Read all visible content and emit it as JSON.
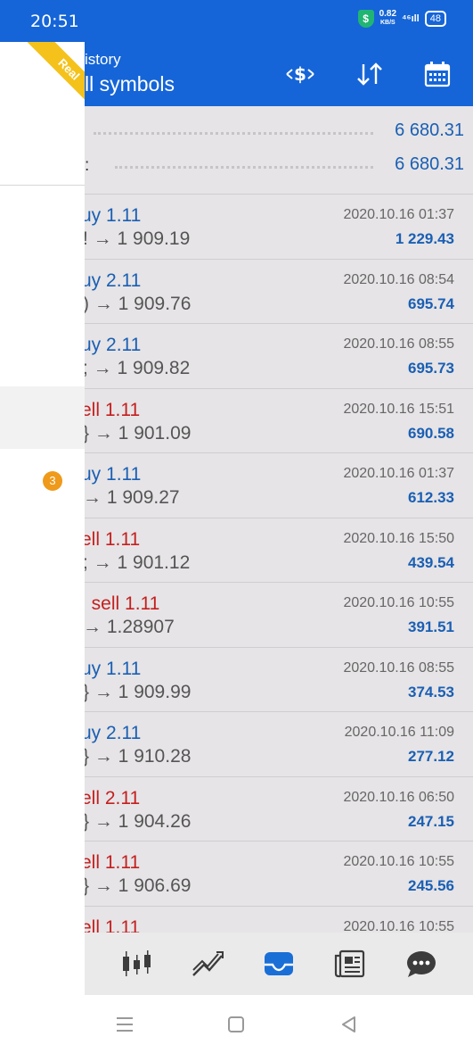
{
  "status_bar": {
    "time": "20:51",
    "speed_top": "0.82",
    "speed_bottom": "KB/S",
    "signal": "⁴⁶ıll",
    "battery": "48"
  },
  "header": {
    "subtitle": "istory",
    "title": "ll symbols"
  },
  "summary": [
    {
      "label": "",
      "value": "6 680.31"
    },
    {
      "label": ":",
      "value": "6 680.31"
    }
  ],
  "trades": [
    {
      "title": "uy 1.11",
      "type": "buy",
      "price": "! → 1 909.19",
      "date": "2020.10.16 01:37",
      "profit": "1 229.43"
    },
    {
      "title": "uy 2.11",
      "type": "buy",
      "price": ") → 1 909.76",
      "date": "2020.10.16 08:54",
      "profit": "695.74"
    },
    {
      "title": "uy 2.11",
      "type": "buy",
      "price": "; → 1 909.82",
      "date": "2020.10.16 08:55",
      "profit": "695.73"
    },
    {
      "title": "ell 1.11",
      "type": "sell",
      "price": "} → 1 901.09",
      "date": "2020.10.16 15:51",
      "profit": "690.58"
    },
    {
      "title": "uy 1.11",
      "type": "buy",
      "price": " → 1 909.27",
      "date": "2020.10.16 01:37",
      "profit": "612.33"
    },
    {
      "title": "ell 1.11",
      "type": "sell",
      "price": "; → 1 901.12",
      "date": "2020.10.16 15:50",
      "profit": "439.54"
    },
    {
      "title": ", sell 1.11",
      "type": "sell",
      "price": " → 1.28907",
      "date": "2020.10.16 10:55",
      "profit": "391.51"
    },
    {
      "title": "uy 1.11",
      "type": "buy",
      "price": "} → 1 909.99",
      "date": "2020.10.16 08:55",
      "profit": "374.53"
    },
    {
      "title": "uy 2.11",
      "type": "buy",
      "price": "} → 1 910.28",
      "date": "2020.10.16 11:09",
      "profit": "277.12"
    },
    {
      "title": "ell 2.11",
      "type": "sell",
      "price": "} → 1 904.26",
      "date": "2020.10.16 06:50",
      "profit": "247.15"
    },
    {
      "title": "ell 1.11",
      "type": "sell",
      "price": "} → 1 906.69",
      "date": "2020.10.16 10:55",
      "profit": "245.56"
    },
    {
      "title": "ell 1.11",
      "type": "sell",
      "price": "",
      "date": "2020.10.16 10:55",
      "profit": ""
    }
  ],
  "drawer": {
    "ribbon": "Real",
    "badge": "3"
  },
  "bottom_nav": [
    {
      "icon": "quotes-candles-icon",
      "active": false
    },
    {
      "icon": "chart-icon",
      "active": false
    },
    {
      "icon": "history-inbox-icon",
      "active": true
    },
    {
      "icon": "news-icon",
      "active": false
    },
    {
      "icon": "chat-icon",
      "active": false
    }
  ],
  "colors": {
    "accent": "#1565d8",
    "buy": "#1a5fb4",
    "sell": "#c41f1f",
    "badge": "#ef9a1a",
    "ribbon": "#f4c21b"
  }
}
